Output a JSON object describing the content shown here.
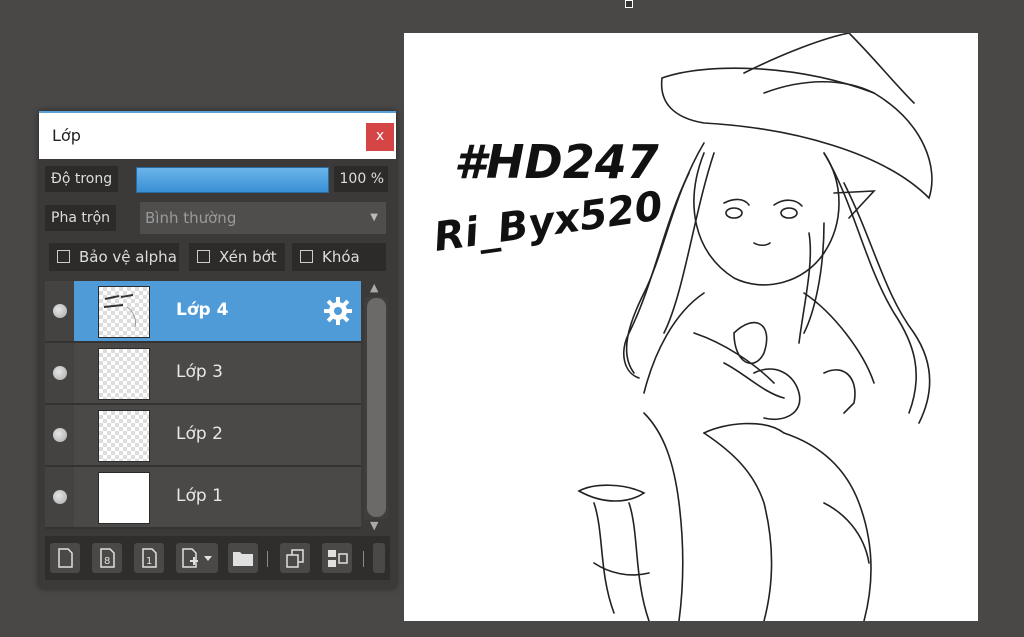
{
  "panel": {
    "title": "Lớp",
    "close_label": "x",
    "opacity_label": "Độ trong",
    "opacity_value": "100 %",
    "opacity_fraction": 1.0,
    "blend_label": "Pha trộn",
    "blend_value": "Bình thường",
    "checkboxes": [
      {
        "label": "Bảo vệ alpha",
        "checked": false
      },
      {
        "label": "Xén bớt",
        "checked": false
      },
      {
        "label": "Khóa",
        "checked": false
      }
    ],
    "layers": [
      {
        "name": "Lớp 4",
        "active": true
      },
      {
        "name": "Lớp 3",
        "active": false
      },
      {
        "name": "Lớp 2",
        "active": false
      },
      {
        "name": "Lớp 1",
        "active": false
      }
    ],
    "toolbar_icons": [
      "new-layer-icon",
      "new-8bit-layer-icon",
      "new-1bit-layer-icon",
      "add-layer-menu-icon",
      "new-folder-icon",
      "duplicate-layer-icon",
      "merge-layer-icon"
    ]
  },
  "canvas": {
    "text_line1": "#HD247",
    "text_line2": "Ri_Byx520"
  },
  "colors": {
    "accent": "#4f9bd8",
    "background": "#4a4846",
    "panel": "#3b3a39",
    "close": "#d64545"
  }
}
